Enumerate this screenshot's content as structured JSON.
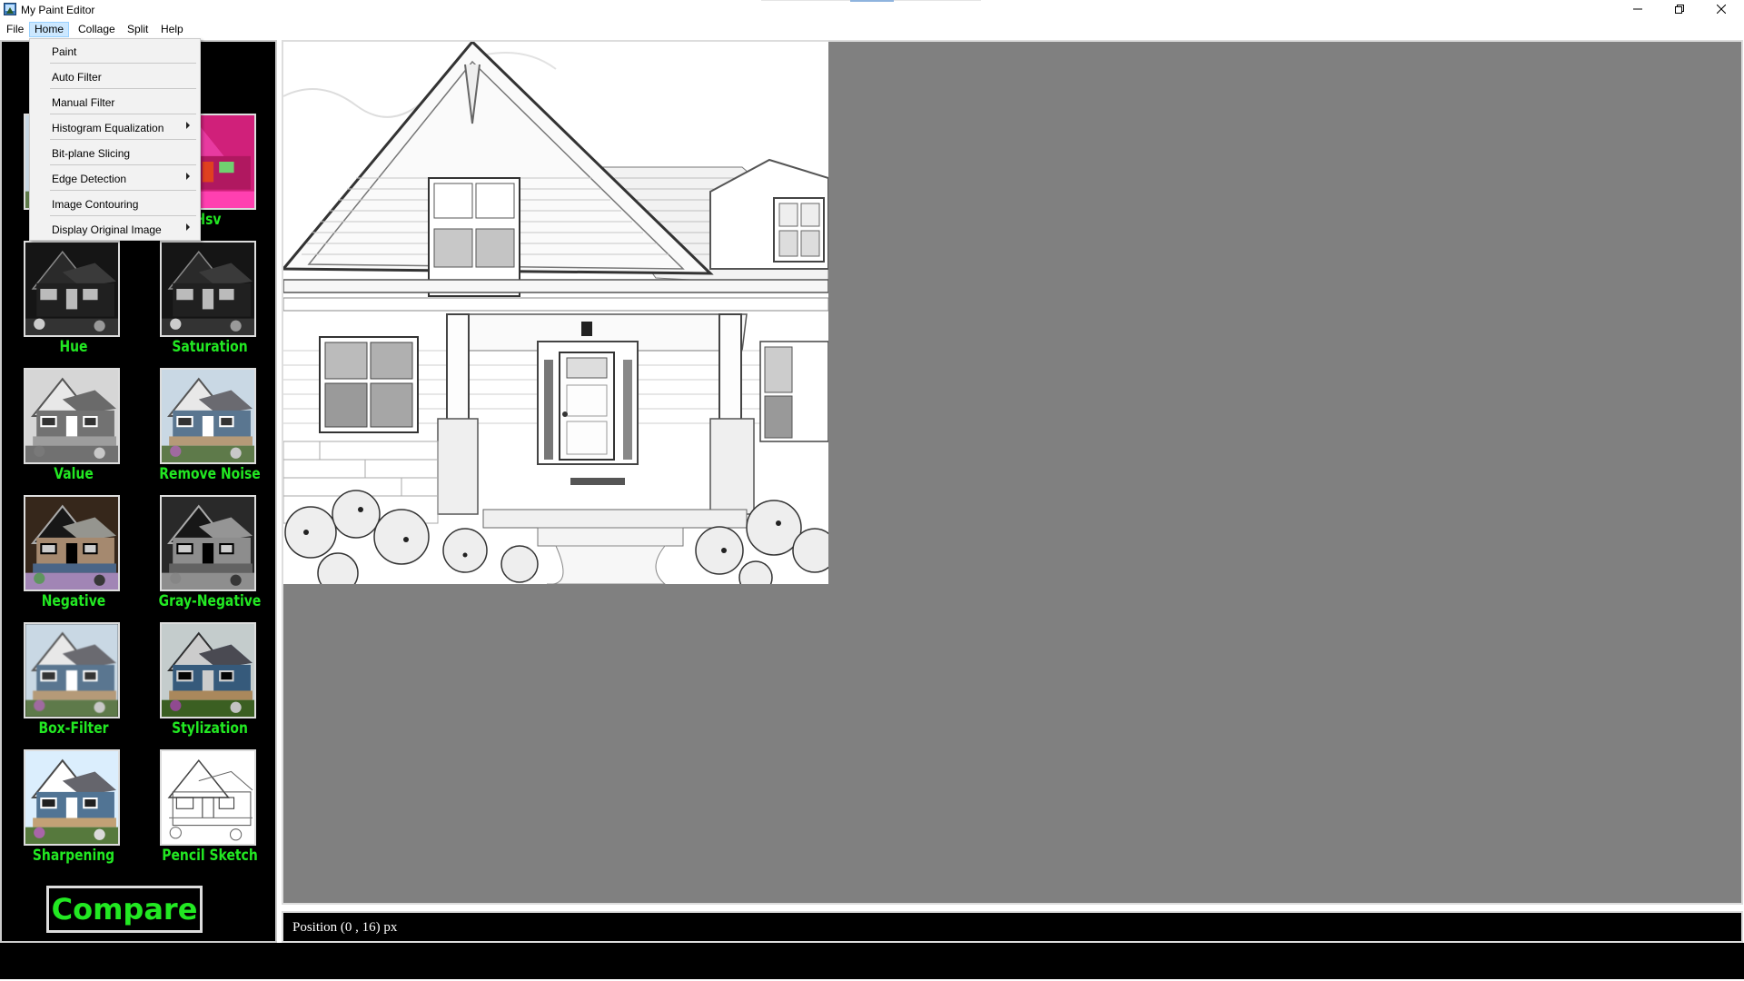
{
  "window": {
    "title": "My Paint Editor"
  },
  "menubar": {
    "items": [
      {
        "label": "File"
      },
      {
        "label": "Home"
      },
      {
        "label": "Collage"
      },
      {
        "label": "Split"
      },
      {
        "label": "Help"
      }
    ],
    "active": "Home"
  },
  "home_menu": {
    "items": [
      {
        "label": "Paint",
        "submenu": false
      },
      {
        "label": "Auto Filter",
        "submenu": false
      },
      {
        "label": "Manual Filter",
        "submenu": false
      },
      {
        "label": "Histogram Equalization",
        "submenu": true
      },
      {
        "label": "Bit-plane Slicing",
        "submenu": false
      },
      {
        "label": "Edge Detection",
        "submenu": true
      },
      {
        "label": "Image Contouring",
        "submenu": false
      },
      {
        "label": "Display Original Image",
        "submenu": true
      }
    ]
  },
  "sidebar": {
    "filters": [
      {
        "label": "Hsv"
      },
      {
        "label": "Hue"
      },
      {
        "label": "Saturation"
      },
      {
        "label": "Value"
      },
      {
        "label": "Remove Noise"
      },
      {
        "label": "Negative"
      },
      {
        "label": "Gray-Negative"
      },
      {
        "label": "Box-Filter"
      },
      {
        "label": "Stylization"
      },
      {
        "label": "Sharpening"
      },
      {
        "label": "Pencil Sketch"
      }
    ],
    "compare_label": "Compare"
  },
  "status": {
    "text": "Position (0 , 16) px"
  },
  "colors": {
    "label_green": "#22e822",
    "canvas_gray": "#808080",
    "menu_highlight": "#cce8ff",
    "sidebar_bg": "#000000"
  },
  "icons": [
    "app-icon",
    "minimize-icon",
    "restore-icon",
    "close-icon",
    "submenu-arrow-icon"
  ]
}
